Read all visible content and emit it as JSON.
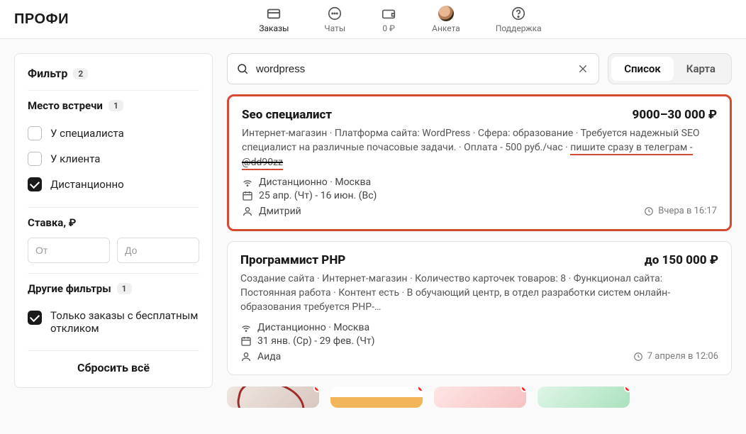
{
  "header": {
    "logo": "ПРОФИ",
    "nav": {
      "orders": "Заказы",
      "chats": "Чаты",
      "balance": "0 ₽",
      "profile": "Анкета",
      "support": "Поддержка"
    }
  },
  "sidebar": {
    "filter_title": "Фильтр",
    "filter_count": "2",
    "meeting_heading": "Место встречи",
    "meeting_count": "1",
    "opt_specialist": "У специалиста",
    "opt_client": "У клиента",
    "opt_remote": "Дистанционно",
    "rate_heading": "Ставка, ₽",
    "rate_from_ph": "От",
    "rate_to_ph": "До",
    "other_heading": "Другие фильтры",
    "other_count": "1",
    "opt_free_response": "Только заказы с бесплатным откликом",
    "reset": "Сбросить всё"
  },
  "search": {
    "value": "wordpress",
    "view_list": "Список",
    "view_map": "Карта"
  },
  "cards": [
    {
      "title": "Seo специалист",
      "price": "9000–30 000 ₽",
      "desc_plain": "Интернет-магазин · Платформа сайта: WordPress · Сфера: образование · Требуется надежный SEO специалист на различные почасовые задачи. · Оплата - 500 руб./час · ",
      "desc_hl": "пишите сразу в телеграм -",
      "desc_handle": "@dd90zz",
      "loc": "Дистанционно · Москва",
      "dates": "25 апр. (Чт) - 16 июн. (Вс)",
      "person": "Дмитрий",
      "posted": "Вчера в 16:17"
    },
    {
      "title": "Программист PHP",
      "price": "до 150 000 ₽",
      "desc_plain": "Создание сайта · Интернет-магазин · Количество карточек товаров: 8 · Функционал сайта: Постоянная работа · Контент есть · В обучающий центр, в отдел разработки систем онлайн-образования требуется PHP-…",
      "loc": "Дистанционно · Москва",
      "dates": "31 янв. (Ср) - 29 фев. (Чт)",
      "person": "Аида",
      "posted": "7 апреля в 12:06"
    }
  ]
}
